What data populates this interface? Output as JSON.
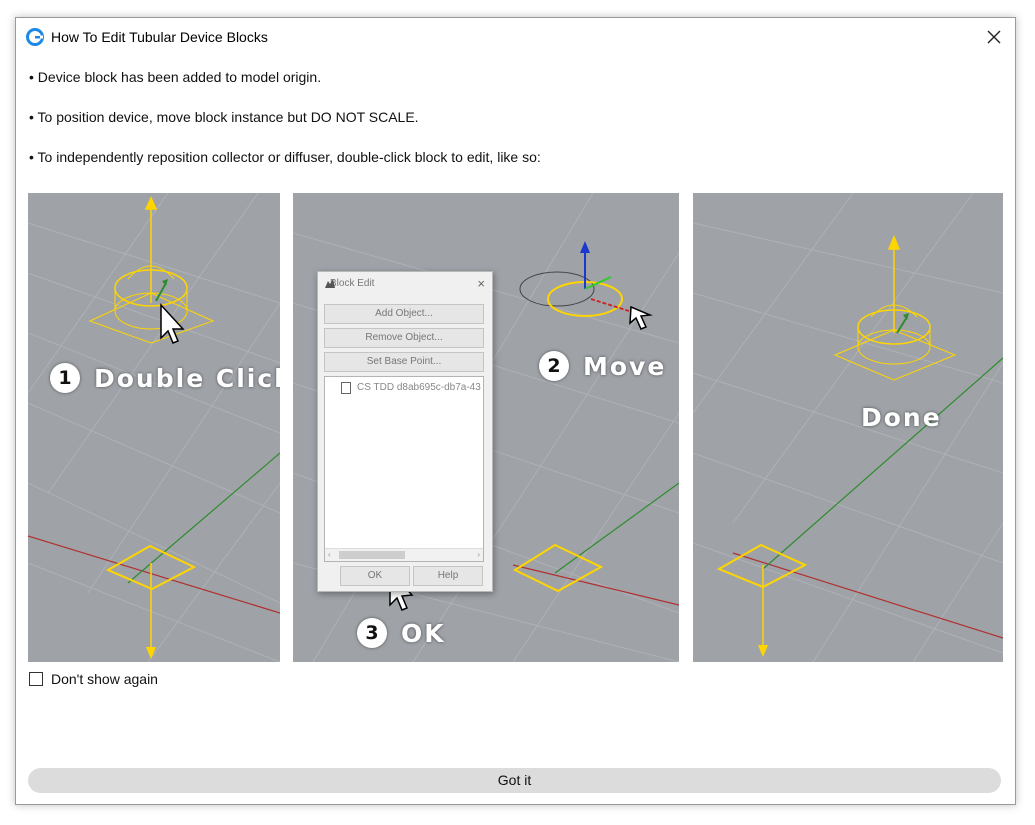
{
  "window": {
    "title": "How To Edit Tubular Device Blocks",
    "icon": "rhino-grasshopper-icon"
  },
  "messages": [
    "• Device block has been added to model origin.",
    "• To position device, move block instance but DO NOT SCALE.",
    "• To independently reposition collector or diffuser, double-click block to edit, like so:"
  ],
  "steps": {
    "step1": {
      "number": "1",
      "label": "Double Click"
    },
    "step2": {
      "number": "2",
      "label": "Move"
    },
    "step3": {
      "number": "3",
      "label": "OK"
    },
    "done": {
      "label": "Done"
    }
  },
  "block_edit_dialog": {
    "title": "Block Edit",
    "buttons": [
      "Add Object...",
      "Remove Object...",
      "Set Base Point..."
    ],
    "list_item": "CS TDD d8ab695c-db7a-43",
    "ok_label": "OK",
    "help_label": "Help"
  },
  "checkbox": {
    "label": "Don't show again",
    "checked": false
  },
  "primary_button": {
    "label": "Got it"
  },
  "colors": {
    "viewport_bg": "#9fa3a8",
    "gizmo_yellow": "#ffd500",
    "axis_green": "#2e8b2e",
    "axis_red": "#b03030",
    "accent_blue": "#1e88e5"
  }
}
